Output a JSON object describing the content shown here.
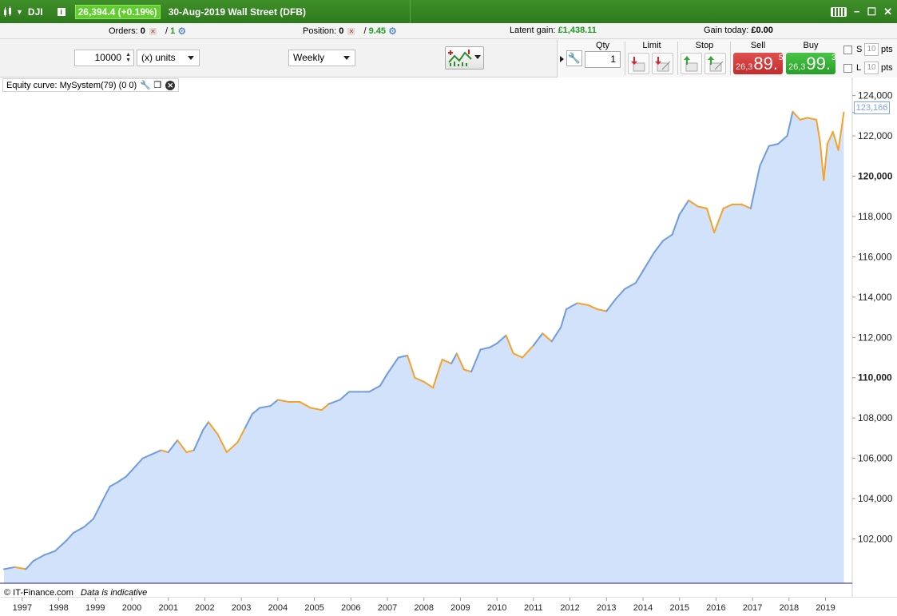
{
  "titlebar": {
    "symbol": "DJI",
    "info_glyph": "i",
    "price_change": "26,394.4 (+0.19%)",
    "title": "30-Aug-2019 Wall Street (DFB)",
    "minimize": "−",
    "maximize": "☐",
    "close": "✕"
  },
  "status": {
    "orders_label": "Orders:",
    "orders_value": "0",
    "orders_sep": "/",
    "orders_active": "1",
    "position_label": "Position:",
    "position_value": "0",
    "position_sep": "/",
    "position_pnl": "9.45",
    "latent_label": "Latent gain:",
    "latent_value": "£1,438.11",
    "gain_today_label": "Gain today:",
    "gain_today_value": "£0.00"
  },
  "toolbar": {
    "quantity_value": "10000",
    "units_value": "(x) units",
    "timeframe_value": "Weekly"
  },
  "trade": {
    "qty_header": "Qty",
    "qty_value": "1",
    "limit_header": "Limit",
    "stop_header": "Stop",
    "sell_header": "Sell",
    "buy_header": "Buy",
    "sell_prefix": "26,3",
    "sell_big": "89.",
    "sell_sup": "5",
    "buy_prefix": "26,3",
    "buy_big": "99.",
    "buy_sup": "3",
    "s_label": "S",
    "l_label": "L",
    "pts_value": "10",
    "pts_label": "pts"
  },
  "chart": {
    "panel_title": "Equity curve: MySystem(79) (0 0)",
    "close_glyph": "✕",
    "last_value_label": "123,166",
    "copyright": "© IT-Finance.com",
    "disclaimer": "Data is indicative"
  },
  "colors": {
    "titlebar_green": "#2d7a1c",
    "equity_line": "#6f9be0",
    "drawdown_line": "#f5a12a",
    "area_fill": "#d2e2fb",
    "baseline": "#1e1e8c",
    "sell_red": "#c52b2b",
    "buy_green": "#289f28"
  },
  "chart_data": {
    "type": "area",
    "title": "Equity curve: MySystem(79) (0 0)",
    "xlabel": "",
    "ylabel": "",
    "xlim": [
      1996.5,
      2019.65
    ],
    "ylim": [
      99800,
      124500
    ],
    "y_ticks": [
      102000,
      104000,
      106000,
      108000,
      110000,
      112000,
      114000,
      116000,
      118000,
      120000,
      122000,
      124000
    ],
    "y_tick_labels": [
      "102,000",
      "104,000",
      "106,000",
      "108,000",
      "110,000",
      "112,000",
      "114,000",
      "116,000",
      "118,000",
      "120,000",
      "122,000",
      "124,000"
    ],
    "x_ticks": [
      1997,
      1998,
      1999,
      2000,
      2001,
      2002,
      2003,
      2004,
      2005,
      2006,
      2007,
      2008,
      2009,
      2010,
      2011,
      2012,
      2013,
      2014,
      2015,
      2016,
      2017,
      2018,
      2019
    ],
    "x_tick_labels": [
      "1997",
      "1998",
      "1999",
      "2000",
      "2001",
      "2002",
      "2003",
      "2004",
      "2005",
      "2006",
      "2007",
      "2008",
      "2009",
      "2010",
      "2011",
      "2012",
      "2013",
      "2014",
      "2015",
      "2016",
      "2017",
      "2018",
      "2019"
    ],
    "last_value": 123166,
    "grid": false,
    "series": [
      {
        "x": [
          1996.5,
          1996.8,
          1997.1,
          1997.3,
          1997.6,
          1997.9,
          1998.2,
          1998.4,
          1998.7,
          1998.95,
          1999.2,
          1999.4,
          1999.6,
          1999.85,
          2000.1,
          2000.3,
          2000.55,
          2000.8,
          2001.0,
          2001.25,
          2001.5,
          2001.7,
          2001.95,
          2002.1,
          2002.35,
          2002.6,
          2002.9,
          2003.1,
          2003.3,
          2003.5,
          2003.8,
          2004.0,
          2004.3,
          2004.6,
          2004.9,
          2005.2,
          2005.4,
          2005.7,
          2005.95,
          2006.2,
          2006.5,
          2006.8,
          2007.0,
          2007.3,
          2007.55,
          2007.75,
          2008.0,
          2008.25,
          2008.5,
          2008.75,
          2008.9,
          2009.1,
          2009.3,
          2009.55,
          2009.8,
          2010.0,
          2010.25,
          2010.45,
          2010.7,
          2011.0,
          2011.25,
          2011.5,
          2011.75,
          2011.9,
          2012.2,
          2012.5,
          2012.75,
          2013.0,
          2013.25,
          2013.5,
          2013.8,
          2014.0,
          2014.3,
          2014.55,
          2014.8,
          2015.0,
          2015.25,
          2015.5,
          2015.75,
          2015.95,
          2016.2,
          2016.45,
          2016.7,
          2016.95,
          2017.2,
          2017.45,
          2017.7,
          2017.95,
          2018.1,
          2018.3,
          2018.5,
          2018.75,
          2018.85,
          2018.95,
          2019.05,
          2019.2,
          2019.35,
          2019.5
        ],
        "y": [
          100500,
          100600,
          100500,
          100900,
          101200,
          101400,
          101900,
          102300,
          102600,
          103000,
          103900,
          104600,
          104800,
          105100,
          105600,
          106000,
          106200,
          106400,
          106300,
          106900,
          106300,
          106400,
          107400,
          107800,
          107200,
          106300,
          106800,
          107500,
          108200,
          108500,
          108600,
          108900,
          108800,
          108800,
          108500,
          108400,
          108700,
          108900,
          109300,
          109300,
          109300,
          109600,
          110200,
          111000,
          111100,
          110000,
          109800,
          109500,
          110900,
          110700,
          111200,
          110400,
          110300,
          111400,
          111500,
          111700,
          112100,
          111200,
          111000,
          111600,
          112200,
          111800,
          112500,
          113400,
          113700,
          113600,
          113400,
          113300,
          113900,
          114400,
          114700,
          115300,
          116200,
          116800,
          117100,
          118100,
          118800,
          118500,
          118400,
          117200,
          118400,
          118600,
          118600,
          118400,
          120500,
          121500,
          121600,
          122000,
          123200,
          122800,
          122900,
          122800,
          121700,
          119800,
          121600,
          122200,
          121300,
          123166
        ]
      }
    ]
  }
}
